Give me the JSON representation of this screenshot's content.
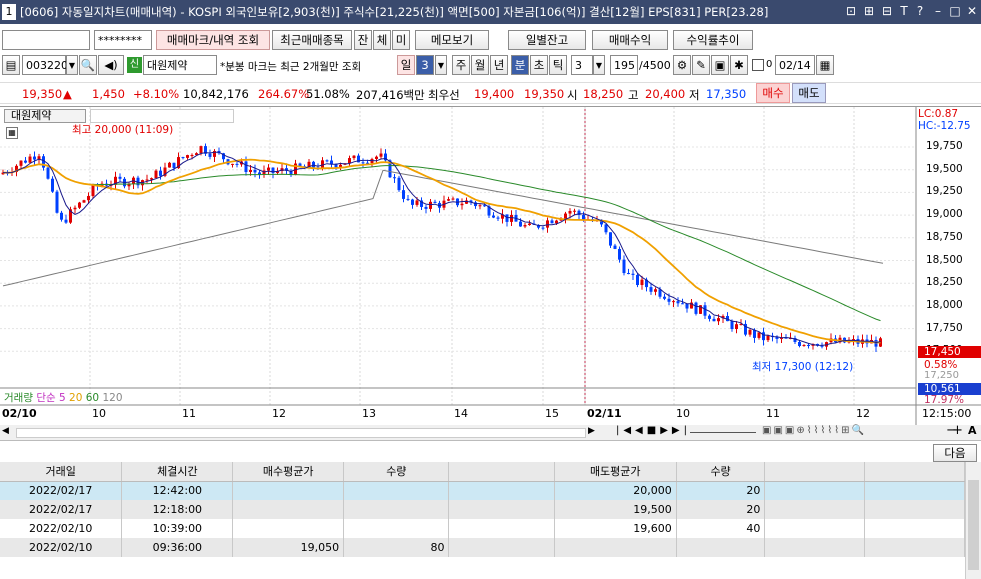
{
  "title": {
    "num": "1",
    "text": "[0606] 자동일지차트(매매내역) - KOSPI 외국인보유[2,903(천)] 주식수[21,225(천)] 액면[500] 자본금[106(억)] 결산[12월] EPS[831] PER[23.28]"
  },
  "toolbar": {
    "password": "********",
    "buttons": [
      "매매마크/내역 조회",
      "최근매매종목",
      "잔",
      "체",
      "미",
      "메모보기",
      "일별잔고",
      "매매수익",
      "수익률추이"
    ]
  },
  "row2": {
    "code": "003220",
    "badge": "신",
    "name": "대원제약",
    "note": "*분봉 마크는 최근 2개월만 조회",
    "periods": [
      "일",
      "3",
      "주",
      "월",
      "년",
      "분",
      "초",
      "틱"
    ],
    "tick_value": "3",
    "count": "195",
    "total": "/4500",
    "date": "02/14"
  },
  "quote": {
    "price": "19,350",
    "arrow": "▲",
    "change": "1,450",
    "pct": "+8.10%",
    "volume": "10,842,176",
    "ratio": "264.67%",
    "ratio2": "51.08%",
    "amount": "207,416백만",
    "best_label": "최우선",
    "ask": "19,400",
    "bid": "19,350",
    "open_label": "시",
    "open": "18,250",
    "high_label": "고",
    "high": "20,400",
    "low_label": "저",
    "low": "17,350",
    "buy": "매수",
    "sell": "매도"
  },
  "chart": {
    "tab": "대원제약",
    "lc": "LC:0.87",
    "hc": "HC:-12.75",
    "high_note": "최고 20,000 (11:09)",
    "low_note": "최저 17,300 (12:12)",
    "price_tag": "17,450",
    "pct_tag": "0.58%",
    "low_tag": "17,250",
    "vol_tag": "10,561",
    "vol_pct": "17.97%",
    "yticks": [
      "19,750",
      "19,500",
      "19,250",
      "19,000",
      "18,750",
      "18,500",
      "18,250",
      "18,000",
      "17,750",
      "17,500"
    ],
    "volume_label": "거래량",
    "vol_ma": [
      "단순 5",
      "20",
      "60",
      "120"
    ],
    "xlabels": [
      "02/10",
      "10",
      "11",
      "12",
      "13",
      "14",
      "15",
      "02/11",
      "10",
      "11",
      "12",
      "12:15:00"
    ]
  },
  "nav": {
    "next": "다음"
  },
  "table": {
    "headers": [
      "거래일",
      "체결시간",
      "매수평균가",
      "수량",
      "",
      "매도평균가",
      "수량",
      "",
      ""
    ],
    "rows": [
      [
        "2022/02/17",
        "12:42:00",
        "",
        "",
        "",
        "20,000",
        "20",
        "",
        ""
      ],
      [
        "2022/02/17",
        "12:18:00",
        "",
        "",
        "",
        "19,500",
        "20",
        "",
        ""
      ],
      [
        "2022/02/10",
        "10:39:00",
        "",
        "",
        "",
        "19,600",
        "40",
        "",
        ""
      ],
      [
        "2022/02/10",
        "09:36:00",
        "19,050",
        "80",
        "",
        "",
        "",
        "",
        ""
      ]
    ]
  },
  "colors": {
    "title_bg": "#3a4a6e",
    "up": "#e00000",
    "down": "#0040ff",
    "ma5": "#1a1a8c",
    "ma20": "#f0a000",
    "ma60": "#1a8c1a",
    "ma120": "#808080"
  }
}
